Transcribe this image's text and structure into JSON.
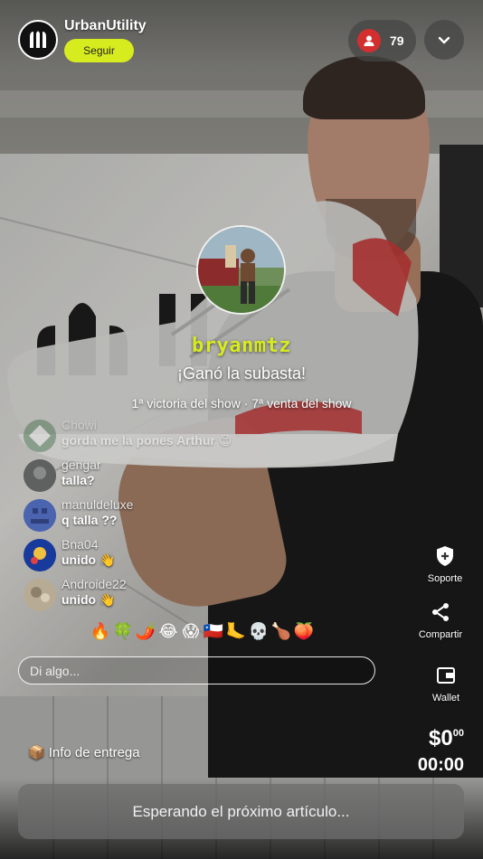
{
  "header": {
    "shop_name": "UrbanUtility",
    "follow_label": "Seguir",
    "viewer_count": "79"
  },
  "winner": {
    "username": "bryanmtz",
    "message": "¡Ganó la subasta!",
    "stats": "1ª victoria del show · 7ª venta del show"
  },
  "chat": {
    "messages": [
      {
        "user": "Chowi",
        "text": "gorda me la pones Arthur 😊"
      },
      {
        "user": "gengar",
        "text": "talla?"
      },
      {
        "user": "manuldeluxe",
        "text": "q talla ??"
      },
      {
        "user": "Bna04",
        "text": "unido 👋"
      },
      {
        "user": "Androide22",
        "text": "unido 👋"
      }
    ],
    "input_placeholder": "Di algo..."
  },
  "reactions": [
    "🔥",
    "🍀",
    "🌶️",
    "😂",
    "😱",
    "🇨🇱",
    "🦶",
    "💀",
    "🍗",
    "🍑"
  ],
  "actions": {
    "support": "Soporte",
    "share": "Compartir",
    "wallet": "Wallet"
  },
  "footer": {
    "delivery_label": "Info de entrega",
    "price_main": "$0",
    "price_cents": "00",
    "timer": "00:00",
    "waiting_label": "Esperando el próximo artículo..."
  },
  "colors": {
    "accent": "#d7ec1f",
    "viewer_badge": "#d32f2f"
  }
}
